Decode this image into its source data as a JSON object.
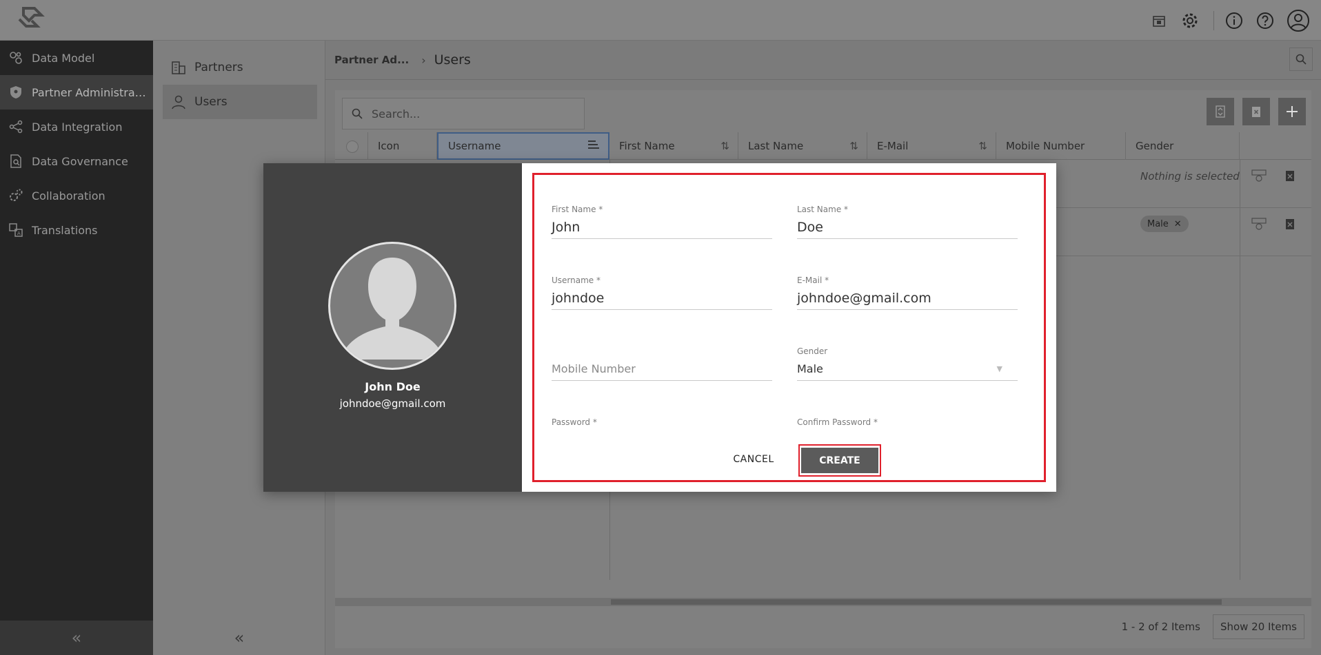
{
  "app": {
    "top_icons": [
      "calendar-icon",
      "gear-icon",
      "info-icon",
      "help-icon",
      "account-icon"
    ]
  },
  "leftnav": {
    "items": [
      {
        "label": "Data Model",
        "icon": "data-model-icon"
      },
      {
        "label": "Partner Administrati...",
        "icon": "shield-icon",
        "active": true
      },
      {
        "label": "Data Integration",
        "icon": "share-nodes-icon"
      },
      {
        "label": "Data Governance",
        "icon": "document-search-icon"
      },
      {
        "label": "Collaboration",
        "icon": "gears-icon"
      },
      {
        "label": "Translations",
        "icon": "translate-icon"
      }
    ],
    "collapse_glyph": "«"
  },
  "subnav": {
    "items": [
      {
        "label": "Partners",
        "icon": "buildings-icon"
      },
      {
        "label": "Users",
        "icon": "user-icon",
        "active": true
      }
    ],
    "collapse_glyph": "«"
  },
  "breadcrumb": {
    "parent": "Partner Ad...",
    "separator": "›",
    "current": "Users"
  },
  "grid": {
    "search_placeholder": "Search...",
    "columns": [
      "Icon",
      "Username",
      "First Name",
      "Last Name",
      "E-Mail",
      "Mobile Number",
      "Gender"
    ],
    "rows": [
      {
        "gender": "Nothing is selected"
      },
      {
        "gender": "Male"
      }
    ],
    "footer": {
      "count": "1 - 2 of 2 Items",
      "show": "Show 20 Items"
    }
  },
  "modal": {
    "profile": {
      "name": "John Doe",
      "email": "johndoe@gmail.com"
    },
    "fields": {
      "first_name": {
        "label": "First Name *",
        "value": "John"
      },
      "last_name": {
        "label": "Last Name *",
        "value": "Doe"
      },
      "username": {
        "label": "Username *",
        "value": "johndoe"
      },
      "email": {
        "label": "E-Mail *",
        "value": "johndoe@gmail.com"
      },
      "mobile": {
        "label": "",
        "placeholder": "Mobile Number"
      },
      "gender": {
        "label": "Gender",
        "value": "Male"
      },
      "password": {
        "label": "Password *"
      },
      "confirm_password": {
        "label": "Confirm Password *"
      }
    },
    "cancel_label": "CANCEL",
    "create_label": "CREATE"
  },
  "colors": {
    "highlight": "#e0202c",
    "sidebar": "#242424",
    "modal_left": "#424242",
    "primary_button": "#5b5b5b"
  }
}
